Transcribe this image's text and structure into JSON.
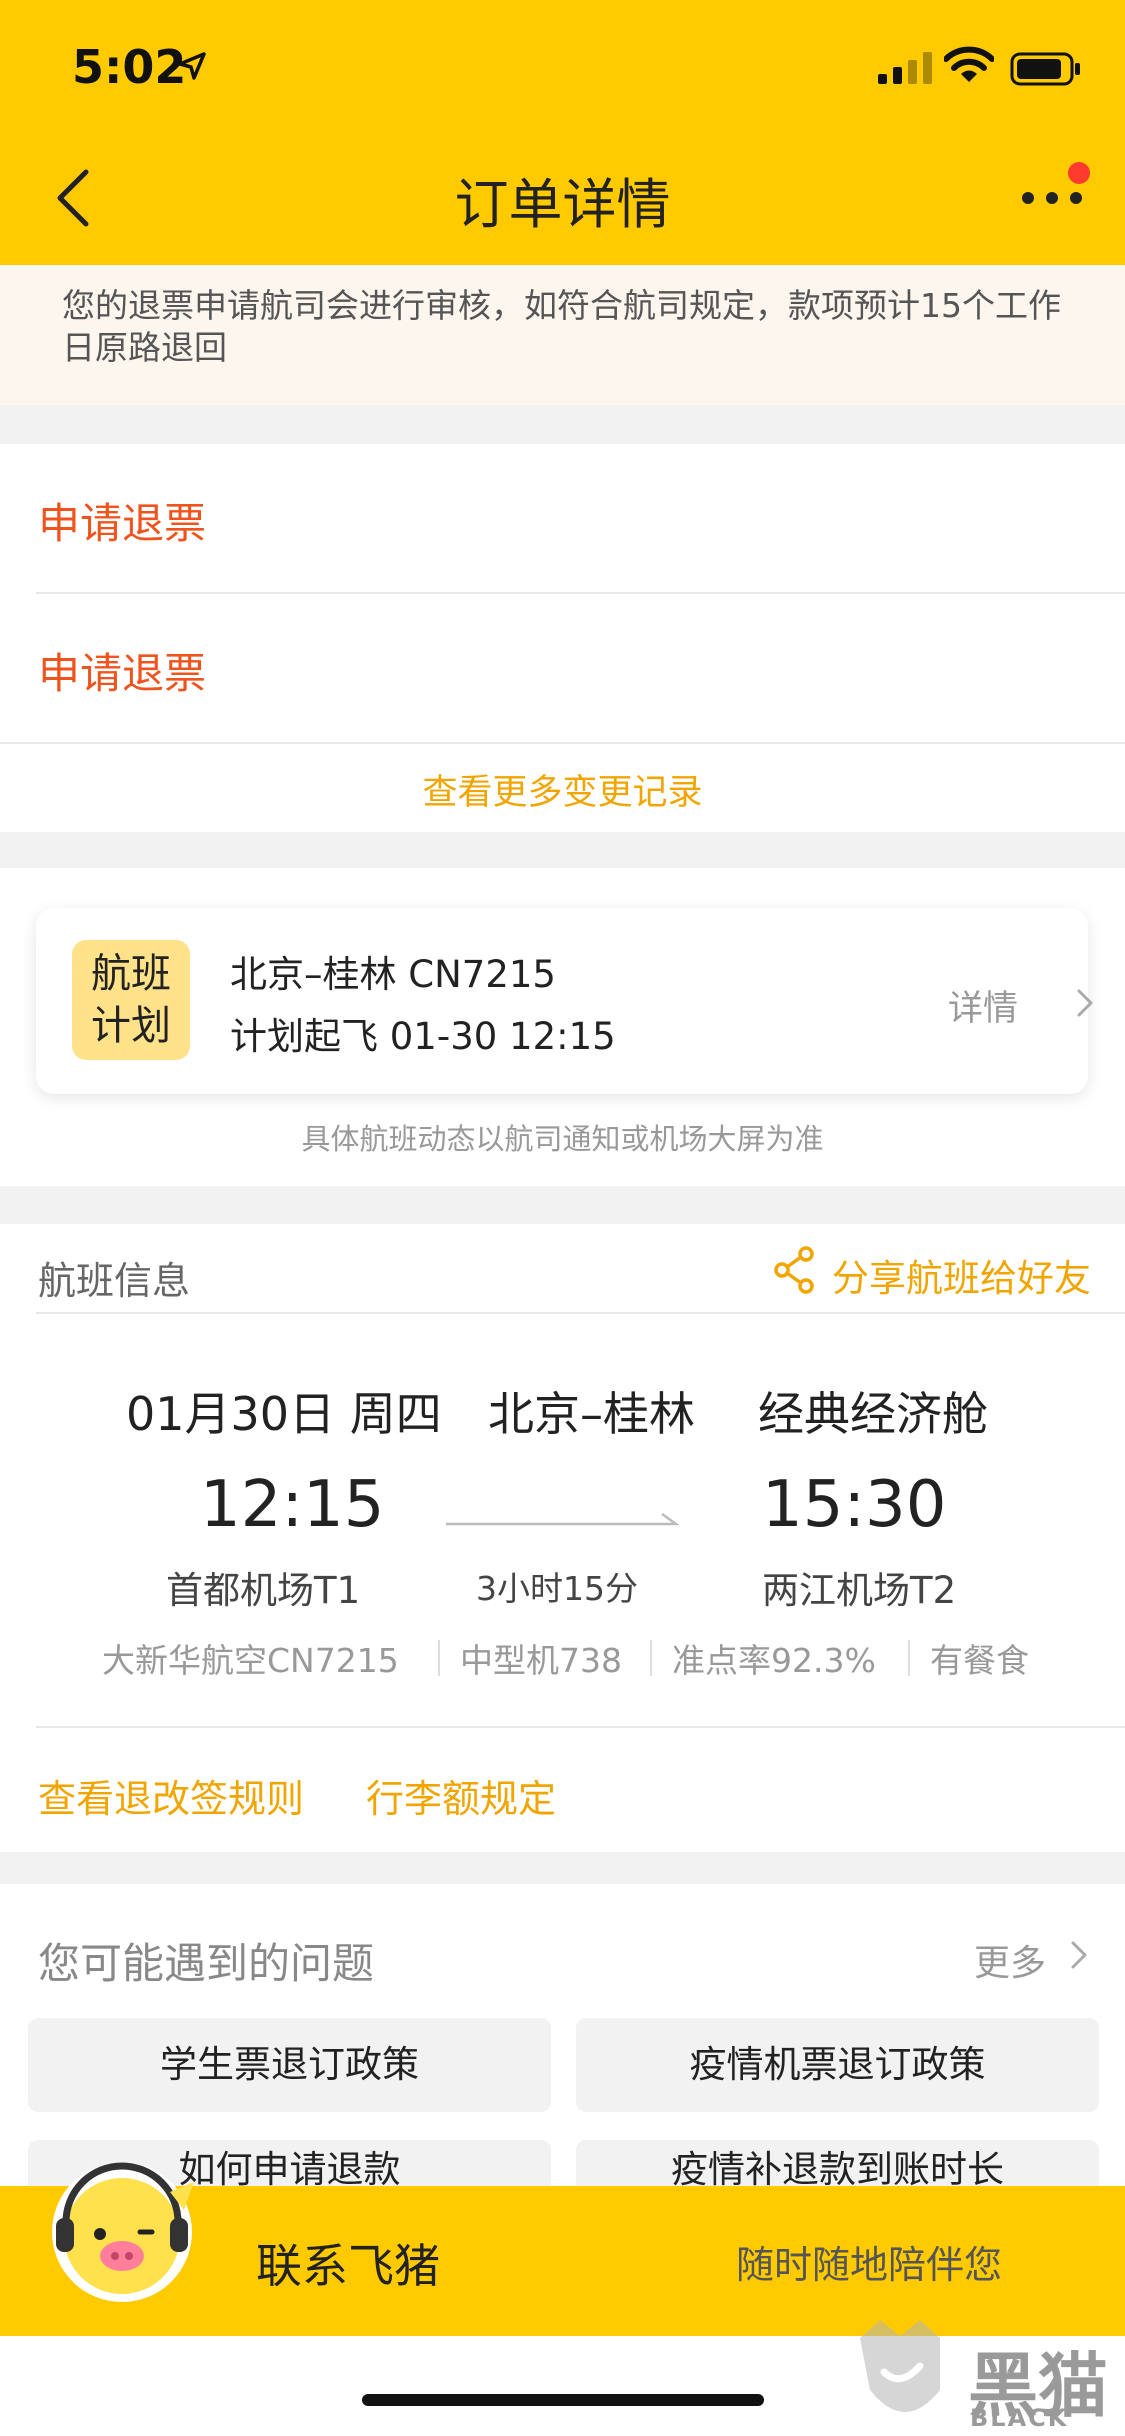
{
  "status_bar": {
    "time": "5:02"
  },
  "nav": {
    "title": "订单详情"
  },
  "notice": {
    "text": "您的退票申请航司会进行审核，如符合航司规定，款项预计15个工作日原路退回"
  },
  "refund": {
    "items": [
      {
        "label": "申请退票"
      },
      {
        "label": "申请退票"
      }
    ],
    "more_records": "查看更多变更记录"
  },
  "flight_plan": {
    "badge_line1": "航班",
    "badge_line2": "计划",
    "route": "北京–桂林 CN7215",
    "departure": "计划起飞 01-30 12:15",
    "detail": "详情",
    "note": "具体航班动态以航司通知或机场大屏为准"
  },
  "flight_info": {
    "section_title": "航班信息",
    "share": "分享航班给好友",
    "date": "01月30日 周四",
    "route": "北京–桂林",
    "cabin": "经典经济舱",
    "dep_time": "12:15",
    "arr_time": "15:30",
    "dep_airport": "首都机场T1",
    "arr_airport": "两江机场T2",
    "duration": "3小时15分",
    "airline": "大新华航空CN7215",
    "aircraft": "中型机738",
    "punctuality": "准点率92.3%",
    "meal": "有餐食",
    "rules_link": "查看退改签规则",
    "baggage_link": "行李额规定"
  },
  "faq": {
    "title": "您可能遇到的问题",
    "more": "更多",
    "items": [
      "学生票退订政策",
      "疫情机票退订政策",
      "如何申请退款",
      "疫情补退款到账时长"
    ]
  },
  "bottom": {
    "contact": "联系飞猪",
    "slogan": "随时随地陪伴您"
  },
  "watermark": {
    "text": "黑猫",
    "sub": "BLACK CAT"
  },
  "colors": {
    "brand_yellow": "#ffcb00",
    "accent_orange": "#f0541e",
    "link_amber": "#f0a500"
  }
}
